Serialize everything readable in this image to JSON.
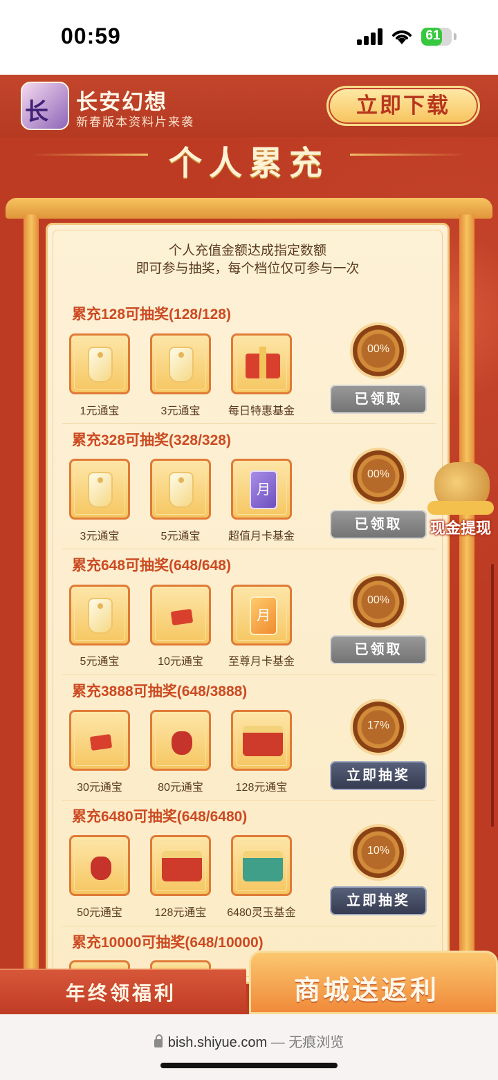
{
  "status": {
    "time": "00:59",
    "battery": "61"
  },
  "header": {
    "app_name": "长安幻想",
    "app_sub": "新春版本资料片来袭",
    "logo_text": "长安",
    "download_label": "立即下载"
  },
  "title": "个人累充",
  "intro_line1": "个人充值金额达成指定数额",
  "intro_line2": "即可参与抽奖，每个档位仅可参与一次",
  "tiers": [
    {
      "title": "累充128可抽奖(128/128)",
      "progress": "00%",
      "button": "已领取",
      "items": [
        {
          "label": "1元通宝",
          "icon": "token-icon"
        },
        {
          "label": "3元通宝",
          "icon": "token-icon"
        },
        {
          "label": "每日特惠基金",
          "icon": "gift-box-icon"
        }
      ]
    },
    {
      "title": "累充328可抽奖(328/328)",
      "progress": "00%",
      "button": "已领取",
      "items": [
        {
          "label": "3元通宝",
          "icon": "token-icon"
        },
        {
          "label": "5元通宝",
          "icon": "token-icon"
        },
        {
          "label": "超值月卡基金",
          "icon": "month-card-icon",
          "glyph": "月"
        }
      ]
    },
    {
      "title": "累充648可抽奖(648/648)",
      "progress": "00%",
      "button": "已领取",
      "items": [
        {
          "label": "5元通宝",
          "icon": "token-icon"
        },
        {
          "label": "10元通宝",
          "icon": "small-gift-icon"
        },
        {
          "label": "至尊月卡基金",
          "icon": "month-card-icon",
          "glyph": "月"
        }
      ]
    },
    {
      "title": "累充3888可抽奖(648/3888)",
      "progress": "17%",
      "button": "立即抽奖",
      "items": [
        {
          "label": "30元通宝",
          "icon": "small-gift-icon"
        },
        {
          "label": "80元通宝",
          "icon": "pouch-icon"
        },
        {
          "label": "128元通宝",
          "icon": "treasure-chest-icon"
        }
      ]
    },
    {
      "title": "累充6480可抽奖(648/6480)",
      "progress": "10%",
      "button": "立即抽奖",
      "items": [
        {
          "label": "50元通宝",
          "icon": "pouch-icon"
        },
        {
          "label": "128元通宝",
          "icon": "treasure-chest-icon"
        },
        {
          "label": "6480灵玉基金",
          "icon": "jade-chest-icon"
        }
      ]
    },
    {
      "title": "累充10000可抽奖(648/10000)"
    }
  ],
  "cash_widget": {
    "label": "现金提现"
  },
  "bottom_tabs": {
    "left": "年终领福利",
    "right": "商城送返利"
  },
  "browser": {
    "url": "bish.shiyue.com",
    "mode": "— 无痕浏览"
  }
}
